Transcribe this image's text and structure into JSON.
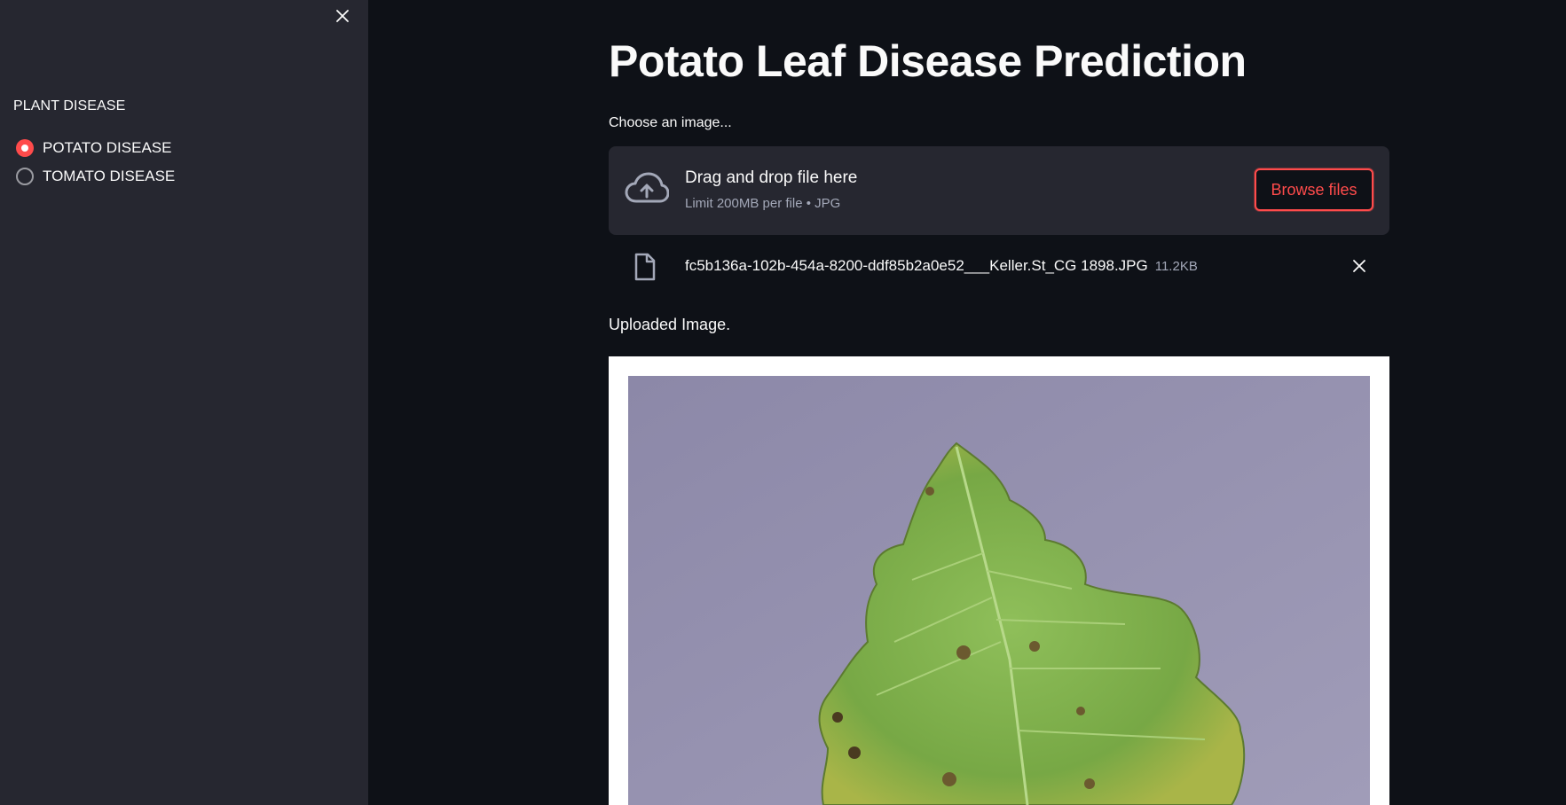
{
  "sidebar": {
    "heading": "PLANT DISEASE",
    "options": [
      {
        "label": "POTATO DISEASE",
        "selected": true
      },
      {
        "label": "TOMATO DISEASE",
        "selected": false
      }
    ],
    "close_icon": "close-icon"
  },
  "main": {
    "title": "Potato Leaf Disease Prediction",
    "uploader": {
      "label": "Choose an image...",
      "drop_text": "Drag and drop file here",
      "limit_text": "Limit 200MB per file • JPG",
      "browse_label": "Browse files",
      "icon": "cloud-upload-icon"
    },
    "file": {
      "name": "fc5b136a-102b-454a-8200-ddf85b2a0e52___Keller.St_CG 1898.JPG",
      "size": "11.2KB",
      "icon": "file-icon",
      "remove_icon": "close-icon"
    },
    "image_caption": "Uploaded Image."
  },
  "colors": {
    "accent": "#ff4b4b",
    "background": "#0e1117",
    "sidebar": "#262730",
    "secondary_text": "#a3a8b8"
  }
}
